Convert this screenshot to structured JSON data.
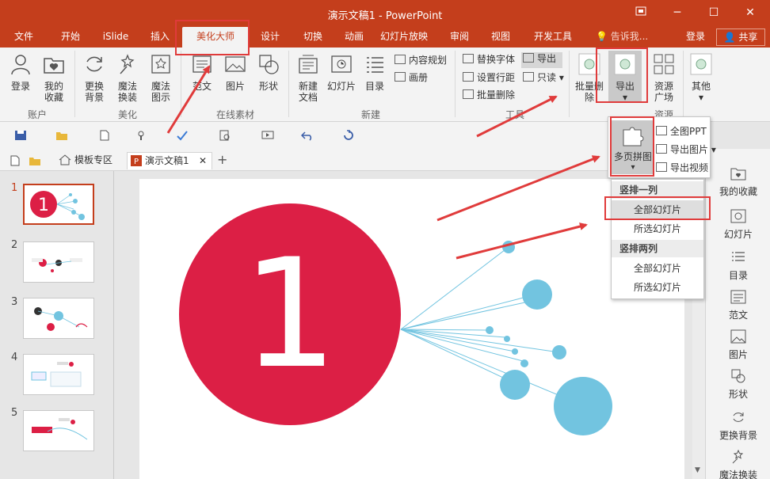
{
  "window": {
    "title": "演示文稿1 - PowerPoint",
    "controls": [
      "restore-icon",
      "minimize-icon",
      "maximize-icon",
      "close-icon"
    ]
  },
  "tabs": [
    {
      "label": "文件"
    },
    {
      "label": "开始"
    },
    {
      "label": "iSlide"
    },
    {
      "label": "插入"
    },
    {
      "label": "美化大师",
      "active": true
    },
    {
      "label": "设计"
    },
    {
      "label": "切换"
    },
    {
      "label": "动画"
    },
    {
      "label": "幻灯片放映"
    },
    {
      "label": "审阅"
    },
    {
      "label": "视图"
    },
    {
      "label": "开发工具"
    }
  ],
  "tellme": "告诉我...",
  "login": "登录",
  "share": "共享",
  "ribbon": {
    "account": {
      "group": "账户",
      "login": "登录",
      "favorites_1": "我的",
      "favorites_2": "收藏"
    },
    "beautify": {
      "group": "美化",
      "replace_bg_1": "更换",
      "replace_bg_2": "背景",
      "magic_swap_1": "魔法",
      "magic_swap_2": "换装",
      "magic_icon_1": "魔法",
      "magic_icon_2": "图示"
    },
    "online": {
      "group": "在线素材",
      "template": "范文",
      "picture": "图片",
      "shape": "形状"
    },
    "new": {
      "group": "新建",
      "new_doc_1": "新建",
      "new_doc_2": "文档",
      "slide": "幻灯片",
      "toc": "目录",
      "content_plan": "内容规划",
      "album": "画册"
    },
    "tools": {
      "group": "工具",
      "replace_font": "替换字体",
      "line_spacing": "设置行距",
      "batch_delete": "批量删除",
      "export": "导出",
      "readonly": "只读"
    },
    "batch": {
      "label_1": "批量删",
      "label_2": "除"
    },
    "export_big": "导出",
    "resource": {
      "group": "资源",
      "label_1": "资源",
      "label_2": "广场"
    },
    "other": "其他"
  },
  "qat": [
    "save-icon",
    "open-icon",
    "new-file-icon",
    "touch-mode-icon",
    "spellcheck-icon",
    "print-preview-icon",
    "slideshow-icon",
    "undo-icon",
    "redo-icon"
  ],
  "doctabs": {
    "template_zone": "模板专区",
    "doc": "演示文稿1"
  },
  "slides": [
    {
      "num": "1"
    },
    {
      "num": "2"
    },
    {
      "num": "3"
    },
    {
      "num": "4"
    },
    {
      "num": "5"
    }
  ],
  "slide_content": {
    "number": "1",
    "accent": "#dc1f45",
    "bubble": "#72c4e0"
  },
  "rpanel": {
    "favorites": "我的收藏",
    "slide": "幻灯片",
    "toc": "目录",
    "template": "范文",
    "picture": "图片",
    "shape": "形状",
    "replace_bg": "更换背景",
    "magic_swap": "魔法换装"
  },
  "dropdown1": {
    "merge": "多页拼图",
    "full_ppt": "全图PPT",
    "export_picture": "导出图片",
    "export_video": "导出视频"
  },
  "dropdown2": {
    "header1": "竖排一列",
    "all1": "全部幻灯片",
    "selected1": "所选幻灯片",
    "header2": "竖排两列",
    "all2": "全部幻灯片",
    "selected2": "所选幻灯片"
  },
  "colors": {
    "titlebar": "#c43e1c",
    "highlight": "#e03b3b"
  }
}
